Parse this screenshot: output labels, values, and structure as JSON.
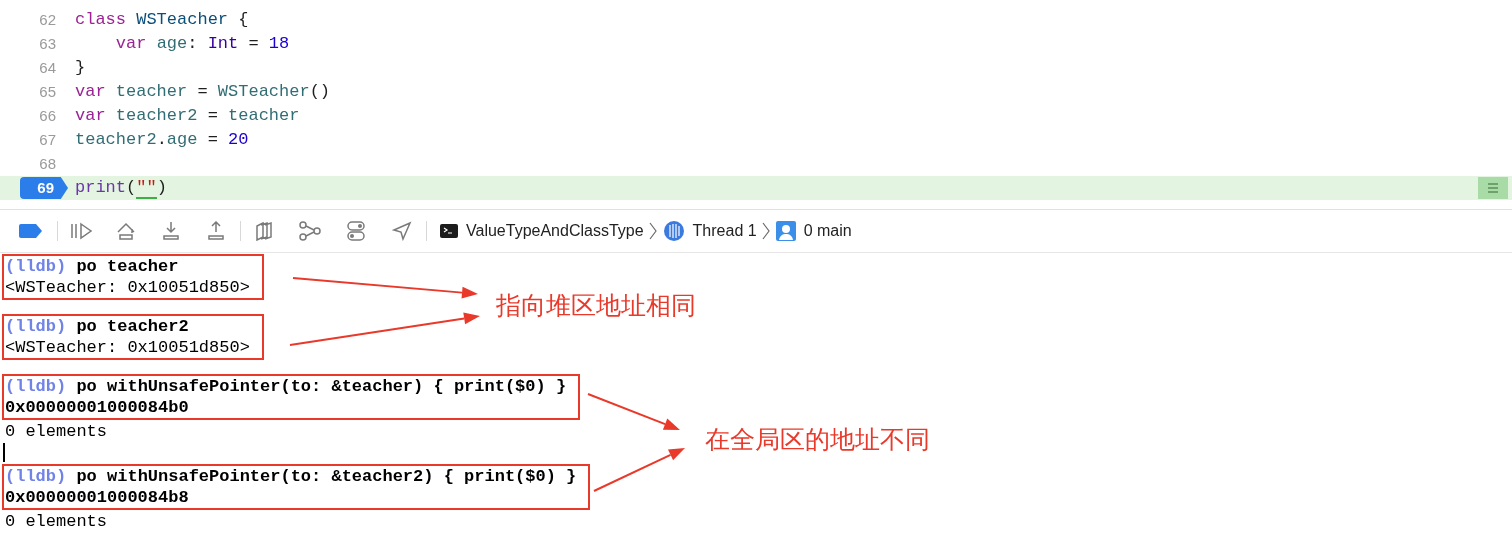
{
  "editor": {
    "lines": [
      {
        "number": "62",
        "tokens": [
          {
            "kind": "keyword",
            "text": "class "
          },
          {
            "kind": "typedecl",
            "text": "WSTeacher"
          },
          {
            "kind": "plain",
            "text": " {"
          }
        ]
      },
      {
        "number": "63",
        "tokens": [
          {
            "kind": "keyword",
            "text": "    var "
          },
          {
            "kind": "ident",
            "text": "age"
          },
          {
            "kind": "plain",
            "text": ": "
          },
          {
            "kind": "type",
            "text": "Int"
          },
          {
            "kind": "plain",
            "text": " = "
          },
          {
            "kind": "number",
            "text": "18"
          }
        ]
      },
      {
        "number": "64",
        "tokens": [
          {
            "kind": "plain",
            "text": "}"
          }
        ]
      },
      {
        "number": "65",
        "tokens": [
          {
            "kind": "keyword",
            "text": "var "
          },
          {
            "kind": "ident",
            "text": "teacher"
          },
          {
            "kind": "plain",
            "text": " = "
          },
          {
            "kind": "ref",
            "text": "WSTeacher"
          },
          {
            "kind": "plain",
            "text": "()"
          }
        ]
      },
      {
        "number": "66",
        "tokens": [
          {
            "kind": "keyword",
            "text": "var "
          },
          {
            "kind": "ident",
            "text": "teacher2"
          },
          {
            "kind": "plain",
            "text": " = "
          },
          {
            "kind": "ref",
            "text": "teacher"
          }
        ]
      },
      {
        "number": "67",
        "tokens": [
          {
            "kind": "ref",
            "text": "teacher2"
          },
          {
            "kind": "plain",
            "text": "."
          },
          {
            "kind": "ref",
            "text": "age"
          },
          {
            "kind": "plain",
            "text": " = "
          },
          {
            "kind": "number",
            "text": "20"
          }
        ]
      },
      {
        "number": "68",
        "current": false
      },
      {
        "number": "69",
        "current": true,
        "tokens": [
          {
            "kind": "function",
            "text": "print"
          },
          {
            "kind": "plain",
            "text": "("
          },
          {
            "kind": "string",
            "text": "\"\""
          },
          {
            "kind": "plain",
            "text": ")"
          }
        ]
      }
    ]
  },
  "debug_bar": {
    "breakpoints_active": true,
    "breadcrumbs": [
      {
        "kind": "process",
        "label": "ValueTypeAndClassType"
      },
      {
        "kind": "thread",
        "label": "Thread 1"
      },
      {
        "kind": "frame",
        "label": "0 main"
      }
    ]
  },
  "console": {
    "groups": [
      {
        "boxed": true,
        "lines": [
          {
            "kind": "command",
            "prompt": "(lldb)",
            "text": "po teacher"
          },
          {
            "kind": "output",
            "text": "<WSTeacher: 0x10051d850>"
          }
        ]
      },
      {
        "boxed": true,
        "lines": [
          {
            "kind": "command",
            "prompt": "(lldb)",
            "text": "po teacher2"
          },
          {
            "kind": "output",
            "text": "<WSTeacher: 0x10051d850>"
          }
        ]
      },
      {
        "boxed": true,
        "lines": [
          {
            "kind": "command",
            "prompt": "(lldb)",
            "text": "po withUnsafePointer(to: &teacher) { print($0) }"
          },
          {
            "kind": "address",
            "text": "0x00000001000084b0"
          }
        ]
      },
      {
        "boxed": false,
        "lines": [
          {
            "kind": "output",
            "text": "0 elements"
          },
          {
            "kind": "cursor"
          }
        ]
      },
      {
        "boxed": true,
        "lines": [
          {
            "kind": "command",
            "prompt": "(lldb)",
            "text": "po withUnsafePointer(to: &teacher2) { print($0) }"
          },
          {
            "kind": "address",
            "text": "0x00000001000084b8"
          }
        ]
      },
      {
        "boxed": false,
        "lines": [
          {
            "kind": "output",
            "text": "0 elements"
          }
        ]
      }
    ]
  },
  "annotations": [
    {
      "text": "指向堆区地址相同"
    },
    {
      "text": "在全局区的地址不同"
    }
  ]
}
